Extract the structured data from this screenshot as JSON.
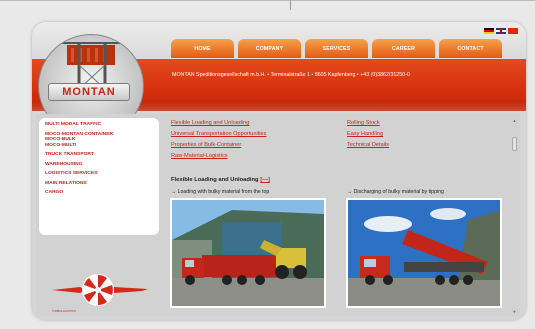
{
  "nav": [
    {
      "label": "HOME"
    },
    {
      "label": "COMPANY"
    },
    {
      "label": "SERVICES"
    },
    {
      "label": "CAREER"
    },
    {
      "label": "CONTACT"
    }
  ],
  "languages": [
    "de-flag",
    "gb-flag",
    "cn-flag"
  ],
  "header": {
    "company_line": "MONTAN Speditionsgesellschaft m.b.H.  •  Terminalstraße 1  •  8605 Kapfenberg  •  +43 (0)3862/31250-0",
    "logo_text": "MONTAN"
  },
  "sidebar": {
    "items": [
      {
        "label": "MULTI MODAL TRAFFIC"
      },
      {
        "label": "MOCO-MONTAN CONTAINER",
        "sub": [
          "MOCO-Bulk",
          "MOCO-Multi"
        ]
      },
      {
        "label": "TRUCK TRANSPORT"
      },
      {
        "label": "WAREHOUSING"
      },
      {
        "label": "LOGISTICS SERVICES"
      },
      {
        "label": "MAIN RELATIONS"
      },
      {
        "label": "CARGO"
      }
    ],
    "tagline": "TURBOLOGISTICS"
  },
  "links": {
    "col1": [
      "Flexible Loading and Unloading",
      "Universal Transportation Opportunities",
      "Properties of Bulk-Container",
      "Raw-Material-Logistics"
    ],
    "col2": [
      "Rolling Stock",
      "Easy Handling",
      "Technical Details"
    ]
  },
  "section": {
    "title": "Flexible Loading and Unloading",
    "bracket": "[—]",
    "caption_left": "→ Loading with bulky material from the top",
    "caption_right": "→ Discharging of bulky material by tipping"
  },
  "colors": {
    "accent_red": "#c8231a",
    "nav_orange": "#e35a14",
    "band_red": "#d8320f"
  },
  "icons": [
    "scroll-up-icon",
    "scroll-down-icon"
  ]
}
